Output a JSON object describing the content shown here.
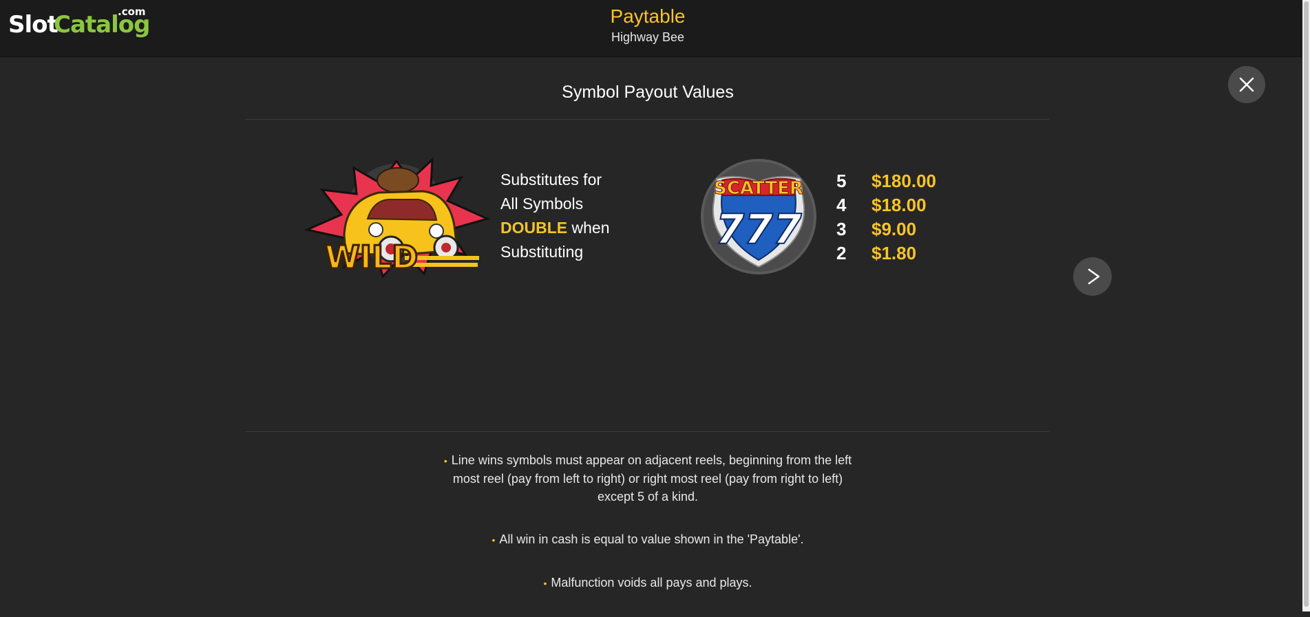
{
  "logo": {
    "part1": "Slot",
    "part2": "Catalog",
    "suffix": ".com"
  },
  "header": {
    "title": "Paytable",
    "subtitle": "Highway Bee"
  },
  "section": {
    "title": "Symbol Payout Values"
  },
  "wild": {
    "image_label": "WILD",
    "line1": "Substitutes for",
    "line2": "All Symbols",
    "highlight": "DOUBLE",
    "line3_rest": " when",
    "line4": "Substituting"
  },
  "scatter": {
    "image_label_top": "SCATTER",
    "image_label_main": "777",
    "pays": [
      {
        "count": "5",
        "amount": "$180.00"
      },
      {
        "count": "4",
        "amount": "$18.00"
      },
      {
        "count": "3",
        "amount": "$9.00"
      },
      {
        "count": "2",
        "amount": "$1.80"
      }
    ]
  },
  "rules": [
    "Line wins symbols must appear on adjacent reels, beginning from the left most reel (pay from left to right) or right most reel (pay from right to left) except 5 of a kind.",
    "All win in cash is equal to value shown in the 'Paytable'.",
    "Malfunction voids all pays and plays."
  ],
  "colors": {
    "accent": "#f7c427",
    "brand_green": "#8cc63f",
    "background": "#262626",
    "header_bg": "#1b1b1b"
  },
  "icons": {
    "close": "close-icon",
    "next": "chevron-right-icon"
  }
}
